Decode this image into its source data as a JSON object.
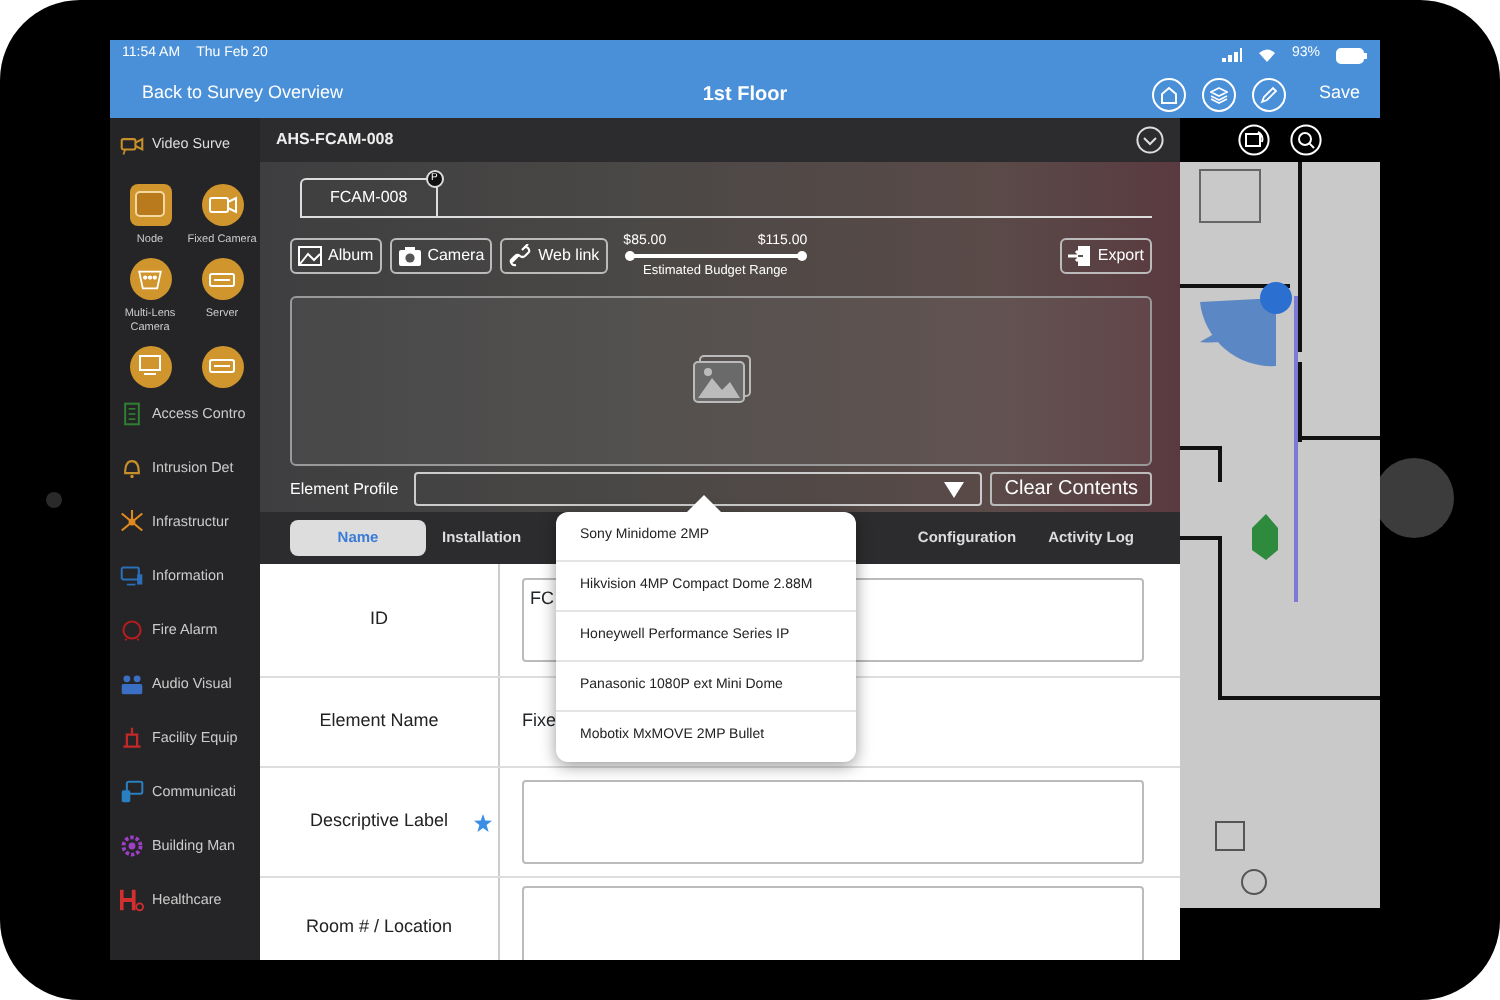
{
  "status_bar": {
    "time": "11:54 AM",
    "date": "Thu Feb 20",
    "battery": "93%"
  },
  "nav_bar": {
    "back": "Back to Survey Overview",
    "title": "1st Floor",
    "save": "Save"
  },
  "sidebar": {
    "categories": [
      {
        "label": "Video Surve",
        "kind": "camera",
        "color": "#c8902a",
        "expanded": true
      },
      {
        "label": "Access Contro",
        "kind": "door",
        "color": "#2e7d32",
        "expanded": false
      },
      {
        "label": "Intrusion Det",
        "kind": "bell",
        "color": "#c8902a",
        "expanded": false
      },
      {
        "label": "Infrastructur",
        "kind": "network",
        "color": "#e08a1e",
        "expanded": false
      },
      {
        "label": "Information",
        "kind": "monitor",
        "color": "#2a6fb8",
        "expanded": false
      },
      {
        "label": "Fire Alarm",
        "kind": "alarm",
        "color": "#b71c1c",
        "expanded": false
      },
      {
        "label": "Audio Visual",
        "kind": "people",
        "color": "#3b6fc4",
        "expanded": false
      },
      {
        "label": "Facility Equip",
        "kind": "tool",
        "color": "#c62828",
        "expanded": false
      },
      {
        "label": "Communicati",
        "kind": "phone",
        "color": "#2a7fc0",
        "expanded": false
      },
      {
        "label": "Building Man",
        "kind": "gear",
        "color": "#9c3fc4",
        "expanded": false
      },
      {
        "label": "Healthcare",
        "kind": "hospital",
        "color": "#d32f2f",
        "expanded": false
      }
    ],
    "elements": [
      {
        "label": "Node",
        "kind": "node"
      },
      {
        "label": "Fixed Camera",
        "kind": "camera"
      },
      {
        "label": "Multi-Lens Camera",
        "kind": "multi"
      },
      {
        "label": "Server",
        "kind": "server"
      },
      {
        "kind": "monitor"
      },
      {
        "kind": "server"
      }
    ]
  },
  "modal": {
    "title": "AHS-FCAM-008",
    "tab": {
      "label": "FCAM-008",
      "badge": "P"
    },
    "actions": [
      {
        "label": "Album",
        "kind": "album"
      },
      {
        "label": "Camera",
        "kind": "camera"
      },
      {
        "label": "Web link",
        "kind": "link"
      }
    ],
    "budget": {
      "min": "$85.00",
      "max": "$115.00",
      "caption": "Estimated Budget Range",
      "level": 1
    },
    "export": "Export",
    "element_profile": {
      "label": "Element Profile"
    },
    "clear": "Clear Contents",
    "section_tabs": [
      {
        "label": "Name",
        "selected": true
      },
      {
        "label": "Installation",
        "selected": false
      },
      {
        "label": "Configuration",
        "selected": false
      },
      {
        "label": "Activity Log",
        "selected": false
      }
    ],
    "form": [
      {
        "label": "ID",
        "kind": "field",
        "required": false,
        "value": "FC"
      },
      {
        "label": "Element Name",
        "kind": "text",
        "required": false,
        "value": "Fixe"
      },
      {
        "label": "Descriptive Label",
        "kind": "field",
        "required": true
      },
      {
        "label": "Room # / Location",
        "kind": "field",
        "required": false
      }
    ],
    "dropdown": {
      "options": [
        "Sony Minidome 2MP",
        "Hikvision 4MP Compact Dome 2.88M",
        "Honeywell Performance Series IP",
        "Panasonic 1080P ext Mini  Dome",
        "Mobotix MxMOVE 2MP Bullet"
      ]
    }
  }
}
